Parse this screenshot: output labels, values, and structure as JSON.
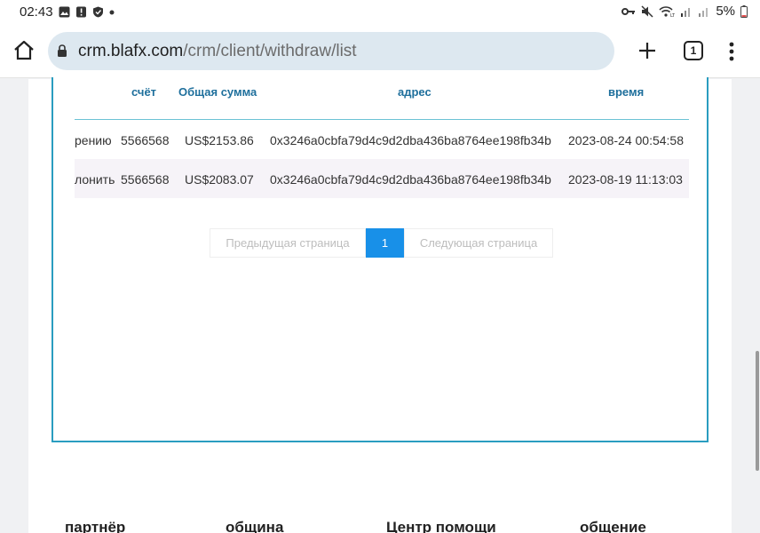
{
  "status_bar": {
    "time": "02:43",
    "battery": "5%"
  },
  "browser": {
    "url_domain": "crm.blafx.com",
    "url_path": "/crm/client/withdraw/list",
    "tab_count": "1"
  },
  "table": {
    "headers": {
      "account": "счёт",
      "total": "Общая сумма",
      "address": "адрес",
      "time": "время"
    },
    "rows": [
      {
        "status": "рению",
        "account": "5566568",
        "total": "US$2153.86",
        "address": "0x3246a0cbfa79d4c9d2dba436ba8764ee198fb34b",
        "time": "2023-08-24 00:54:58"
      },
      {
        "status": "лонить",
        "account": "5566568",
        "total": "US$2083.07",
        "address": "0x3246a0cbfa79d4c9d2dba436ba8764ee198fb34b",
        "time": "2023-08-19 11:13:03"
      }
    ]
  },
  "pagination": {
    "prev_label": "Предыдущая страница",
    "current": "1",
    "next_label": "Следующая страница"
  },
  "footer": {
    "col1": "партнёр",
    "col2": "община",
    "col3": "Центр помощи",
    "col4": "общение"
  }
}
